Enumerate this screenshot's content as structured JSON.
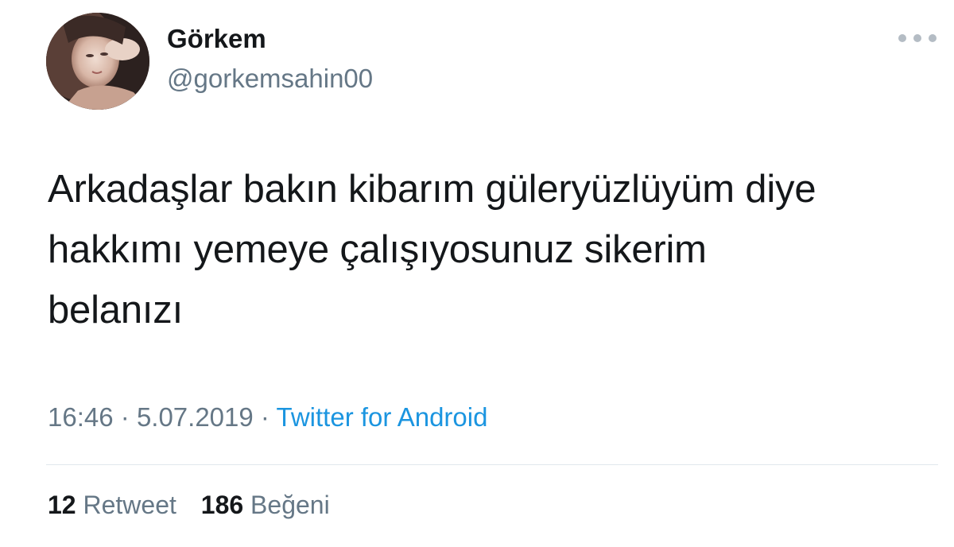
{
  "tweet": {
    "author": {
      "display_name": "Görkem",
      "handle": "@gorkemsahin00"
    },
    "text_lines": [
      "Arkadaşlar bakın kibarım güleryüzlüyüm diye",
      "hakkımı yemeye çalışıyosunuz sikerim",
      "belanızı"
    ],
    "time": "16:46",
    "separator": "·",
    "date": "5.07.2019",
    "source": "Twitter for Android",
    "stats": {
      "retweets_count": "12",
      "retweets_label": "Retweet",
      "likes_count": "186",
      "likes_label": "Beğeni"
    },
    "more_icon": "more-horizontal-icon"
  },
  "colors": {
    "text_primary": "#14171a",
    "text_secondary": "#657786",
    "link": "#1b95e0",
    "divider": "#e1e8ed"
  }
}
